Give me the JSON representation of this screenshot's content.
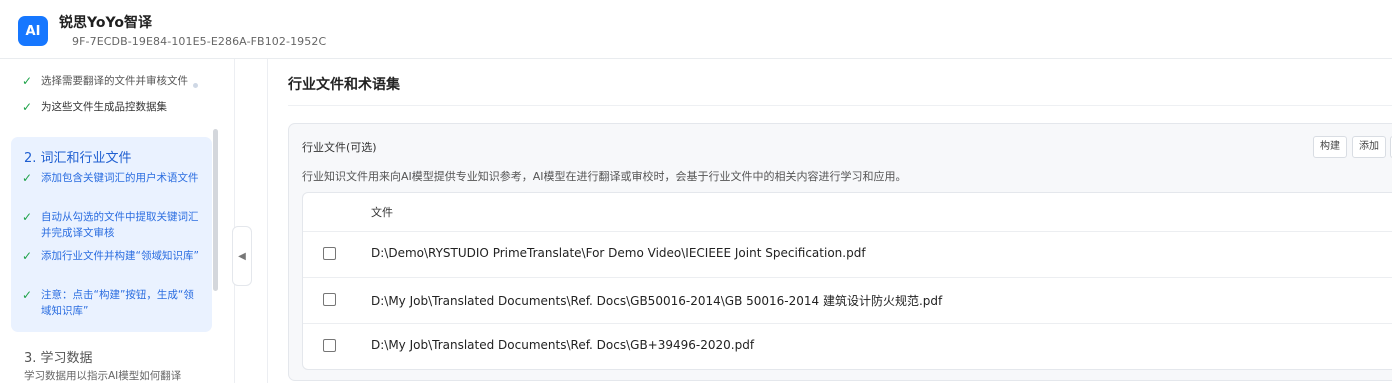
{
  "header": {
    "logo_text": "AI",
    "title": "锐思YoYo智译",
    "project_id": "9F-7ECDB-19E84-101E5-E286A-FB102-1952C"
  },
  "sidebar": {
    "partial_items": [
      {
        "label": "选择需要翻译的文件并审核文件"
      },
      {
        "label": "为这些文件生成品控数据集"
      }
    ],
    "active_step": {
      "title": "2. 词汇和行业文件",
      "items": [
        {
          "label": "添加包含关键词汇的用户术语文件"
        },
        {
          "label": "自动从勾选的文件中提取关键词汇并完成译文审核"
        },
        {
          "label": "添加行业文件并构建“领域知识库”"
        },
        {
          "label": "注意：点击“构建”按钮，生成“领域知识库”"
        }
      ]
    },
    "next_step": {
      "title": "3. 学习数据",
      "desc": "学习数据用以指示AI模型如何翻译"
    }
  },
  "collapse_icon": "chevron-left-icon",
  "main": {
    "section_title": "行业文件和术语集",
    "card": {
      "title": "行业文件(可选)",
      "buttons": {
        "build": "构建",
        "add": "添加"
      },
      "description": "行业知识文件用来向AI模型提供专业知识参考，AI模型在进行翻译或审校时，会基于行业文件中的相关内容进行学习和应用。",
      "table": {
        "column_file": "文件",
        "rows": [
          {
            "file": "D:\\Demo\\RYSTUDIO PrimeTranslate\\For Demo Video\\IECIEEE Joint Specification.pdf",
            "checked": false
          },
          {
            "file": "D:\\My Job\\Translated Documents\\Ref. Docs\\GB50016-2014\\GB 50016-2014 建筑设计防火规范.pdf",
            "checked": false
          },
          {
            "file": "D:\\My Job\\Translated Documents\\Ref. Docs\\GB+39496-2020.pdf",
            "checked": false
          }
        ]
      }
    }
  },
  "colors": {
    "accent": "#1677ff",
    "active_bg": "#eaf2ff",
    "check": "#1fa34a"
  }
}
